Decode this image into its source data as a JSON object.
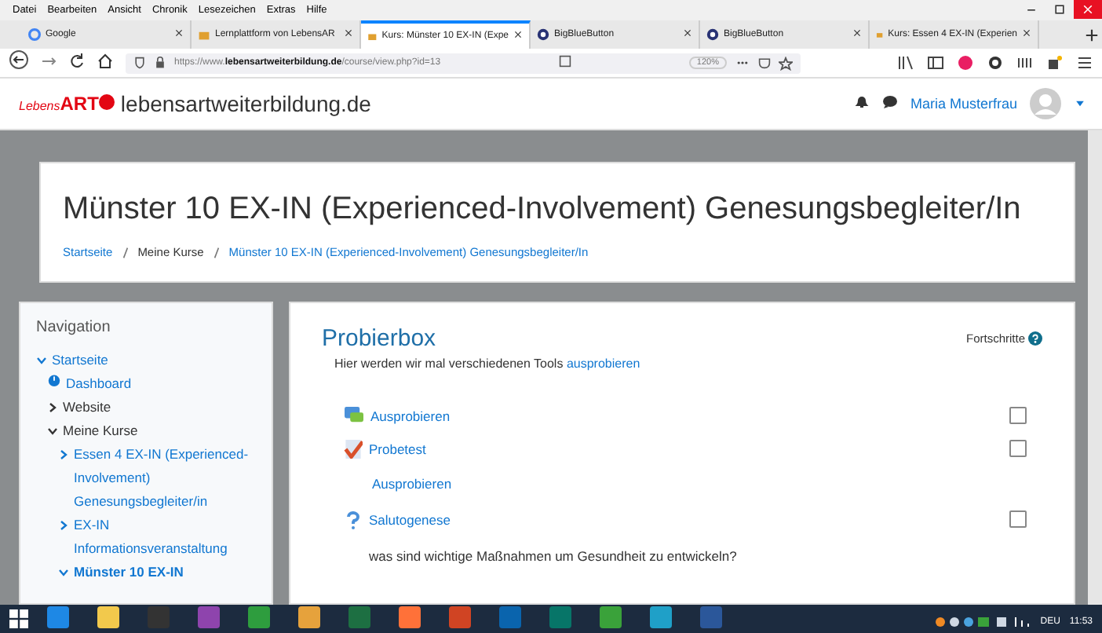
{
  "menu_bar": [
    "Datei",
    "Bearbeiten",
    "Ansicht",
    "Chronik",
    "Lesezeichen",
    "Extras",
    "Hilfe"
  ],
  "tabs": [
    {
      "label": "Google",
      "kind": "google",
      "selected": false
    },
    {
      "label": "Lernplattform von LebensAR",
      "kind": "site",
      "selected": false
    },
    {
      "label": "Kurs: Münster 10 EX-IN (Expe",
      "kind": "site",
      "selected": true
    },
    {
      "label": "BigBlueButton",
      "kind": "bbb",
      "selected": false
    },
    {
      "label": "BigBlueButton",
      "kind": "bbb",
      "selected": false
    },
    {
      "label": "Kurs: Essen 4 EX-IN (Experien",
      "kind": "site",
      "selected": false
    }
  ],
  "address_bar": {
    "url": "https://www.**lebensartweiterbildung.de**/course/view.php?id=13",
    "zoom": "120%"
  },
  "site_header": {
    "logo": "Lebens**ART**",
    "site_name": "lebensartweiterbildung.de",
    "user_name": "Maria Musterfrau"
  },
  "course_header": {
    "title": "Münster 10 EX-IN (Experienced-Involvement) Genesungsbegleiter/In",
    "breadcrumbs": [
      {
        "label": "Startseite",
        "link": true
      },
      {
        "label": "Meine Kurse",
        "link": false
      },
      {
        "label": "Münster 10 EX-IN (Experienced-Involvement) Genesungsbegleiter/In",
        "link": true
      }
    ]
  },
  "navigation": {
    "title": "Navigation",
    "items": [
      {
        "label": "Startseite",
        "kind": "branch",
        "link": true,
        "expanded": true,
        "selected": false,
        "children": [
          {
            "label": "Dashboard",
            "kind": "dashboard",
            "link": true,
            "selected": false
          },
          {
            "label": "Website",
            "kind": "branch",
            "link": false,
            "expanded": false,
            "selected": false
          },
          {
            "label": "Meine Kurse",
            "kind": "branch",
            "link": false,
            "expanded": true,
            "selected": false,
            "children": [
              {
                "label": "Essen 4 EX-IN (Experienced-Involvement) Genesungsbegleiter/in",
                "kind": "branch",
                "link": true,
                "expanded": false,
                "selected": false
              },
              {
                "label": "EX-IN Informationsveranstaltung",
                "kind": "branch",
                "link": true,
                "expanded": false,
                "selected": false
              },
              {
                "label": "Münster 10 EX-IN",
                "kind": "branch",
                "link": true,
                "expanded": true,
                "selected": true
              }
            ]
          }
        ]
      }
    ]
  },
  "section": {
    "title": "Probierbox",
    "progress_label": "Fortschritte",
    "summary": "Hier werden wir mal verschiedenen Tools",
    "summary_link": "ausprobieren",
    "activities": [
      {
        "kind": "forum",
        "label": "Ausprobieren",
        "checked": false
      },
      {
        "kind": "quiz",
        "label": "Probetest",
        "checked": false
      },
      {
        "kind": "label",
        "label": "Ausprobieren"
      },
      {
        "kind": "feedback",
        "label": "Salutogenese",
        "checked": false
      }
    ],
    "footer_text": "was sind wichtige Maßnahmen um Gesundheit zu entwickeln?"
  },
  "taskbar": {
    "apps": [
      {
        "kind": "ie"
      },
      {
        "kind": "explorer"
      },
      {
        "kind": "camera"
      },
      {
        "kind": "photos"
      },
      {
        "kind": "store"
      },
      {
        "kind": "paint"
      },
      {
        "kind": "excel"
      },
      {
        "kind": "firefox"
      },
      {
        "kind": "powerpoint"
      },
      {
        "kind": "outlook"
      },
      {
        "kind": "publisher"
      },
      {
        "kind": "calculator"
      },
      {
        "kind": "edge"
      },
      {
        "kind": "word"
      }
    ],
    "language": "DEU",
    "time": "11:53"
  }
}
